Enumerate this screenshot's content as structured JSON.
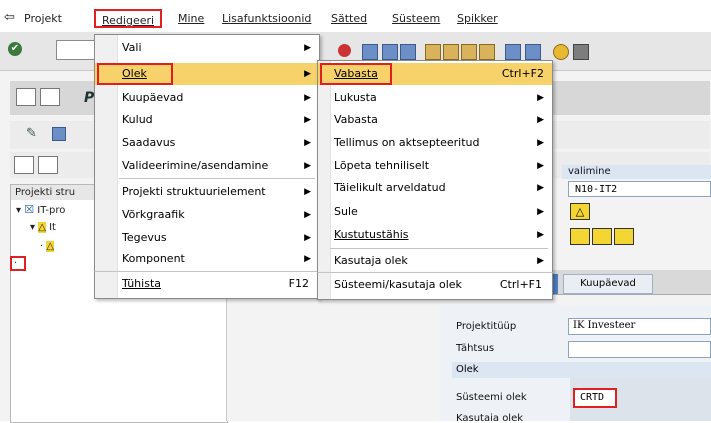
{
  "menubar": {
    "items": [
      {
        "label": "Projekt"
      },
      {
        "label": "Redigeeri"
      },
      {
        "label": "Mine"
      },
      {
        "label": "Lisafunktsioonid"
      },
      {
        "label": "Sätted"
      },
      {
        "label": "Süsteem"
      },
      {
        "label": "Spikker"
      }
    ]
  },
  "app": {
    "title_partial": "P"
  },
  "redigeeri_menu": [
    {
      "label": "Vali",
      "submenu": true
    },
    {
      "label": "Olek",
      "submenu": true
    },
    {
      "label": "Kuupäevad",
      "submenu": true
    },
    {
      "label": "Kulud",
      "submenu": true
    },
    {
      "label": "Saadavus",
      "submenu": true
    },
    {
      "label": "Valideerimine/asendamine",
      "submenu": true
    },
    {
      "label": "Projekti struktuurielement",
      "submenu": true
    },
    {
      "label": "Võrkgraafik",
      "submenu": true
    },
    {
      "label": "Tegevus",
      "submenu": true
    },
    {
      "label": "Komponent",
      "submenu": true
    },
    {
      "label": "Tühista",
      "shortcut": "F12"
    }
  ],
  "olek_submenu": [
    {
      "label": "Vabasta",
      "shortcut": "Ctrl+F2"
    },
    {
      "label": "Lukusta",
      "submenu": true
    },
    {
      "label": "Vabasta",
      "submenu": true
    },
    {
      "label": "Tellimus on aktsepteeritud",
      "submenu": true
    },
    {
      "label": "Lõpeta tehniliselt",
      "submenu": true
    },
    {
      "label": "Täielikult arveldatud",
      "submenu": true
    },
    {
      "label": "Sule",
      "submenu": true
    },
    {
      "label": "Kustutustähis",
      "submenu": true
    },
    {
      "label": "Kasutaja olek",
      "submenu": true
    },
    {
      "label": "Süsteemi/kasutaja olek",
      "shortcut": "Ctrl+F1"
    }
  ],
  "tree": {
    "header": "Projekti stru",
    "root": "IT-pro",
    "child": "It"
  },
  "detail": {
    "header_partial": "valimine",
    "field1": "N10-IT2",
    "tab_label": "Kuupäevad",
    "projektituup_label": "Projektitüüp",
    "projektituup_value": "IK Investeer",
    "tahtsus_label": "Tähtsus",
    "olek_group": "Olek",
    "systeemi_olek_label": "Süsteemi olek",
    "systeemi_olek_value": "CRTD",
    "kasutaja_olek_label": "Kasutaja olek"
  },
  "colors": {
    "highlight": "#f7d16a",
    "annotation_red": "#e02020",
    "warning_yellow": "#f3d634"
  }
}
